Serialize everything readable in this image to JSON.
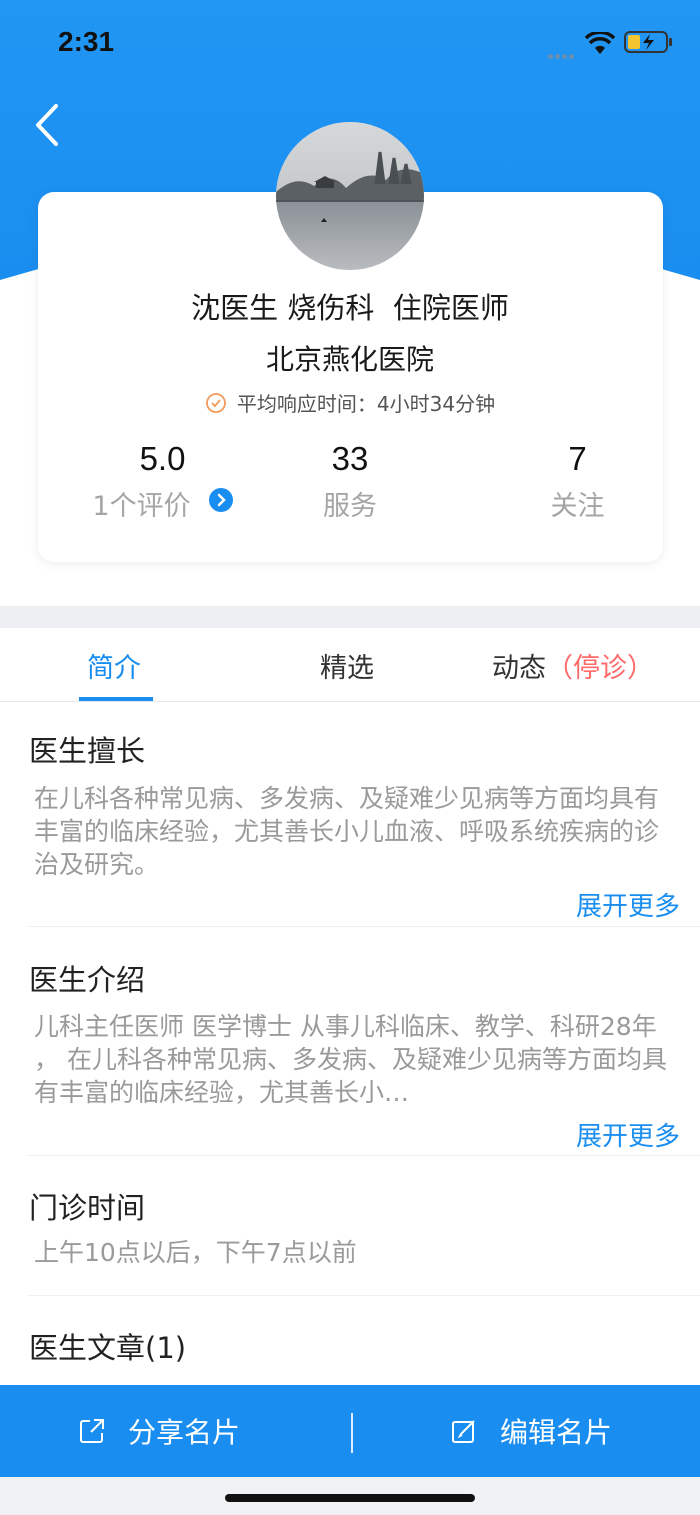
{
  "status_bar": {
    "time": "2:31",
    "icons": [
      "signal-icon",
      "wifi-icon",
      "battery-icon"
    ]
  },
  "header": {
    "back_icon": "chevron-left-icon",
    "accent_color": "#1a8ef0"
  },
  "profile": {
    "doctor_line": "沈医生 烧伤科  住院医师",
    "hospital": "北京燕化医院",
    "response_label": "平均响应时间：",
    "response_value": "4小时34分钟",
    "stats": [
      {
        "value": "5.0",
        "label": "1个评价"
      },
      {
        "value": "33",
        "label": "服务"
      },
      {
        "value": "7",
        "label": "关注"
      }
    ]
  },
  "tabs": [
    {
      "label": "简介",
      "active": true
    },
    {
      "label": "精选",
      "active": false
    },
    {
      "label": "动态",
      "suffix": "（停诊）",
      "active": false
    }
  ],
  "sections": {
    "expertise": {
      "title": "医生擅长",
      "text": "在儿科各种常见病、多发病、及疑难少见病等方面均具有丰富的临床经验，尤其善长小儿血液、呼吸系统疾病的诊治及研究。",
      "more": "展开更多"
    },
    "intro": {
      "title": "医生介绍",
      "text": "儿科主任医师 医学博士 从事儿科临床、教学、科研28年 ， 在儿科各种常见病、多发病、及疑难少见病等方面均具有丰富的临床经验，尤其善长小…",
      "more": "展开更多"
    },
    "clinic_time": {
      "title": "门诊时间",
      "text": "上午10点以后，下午7点以前"
    },
    "articles": {
      "title": "医生文章(1)"
    }
  },
  "bottom_bar": {
    "share_label": "分享名片",
    "edit_label": "编辑名片"
  }
}
